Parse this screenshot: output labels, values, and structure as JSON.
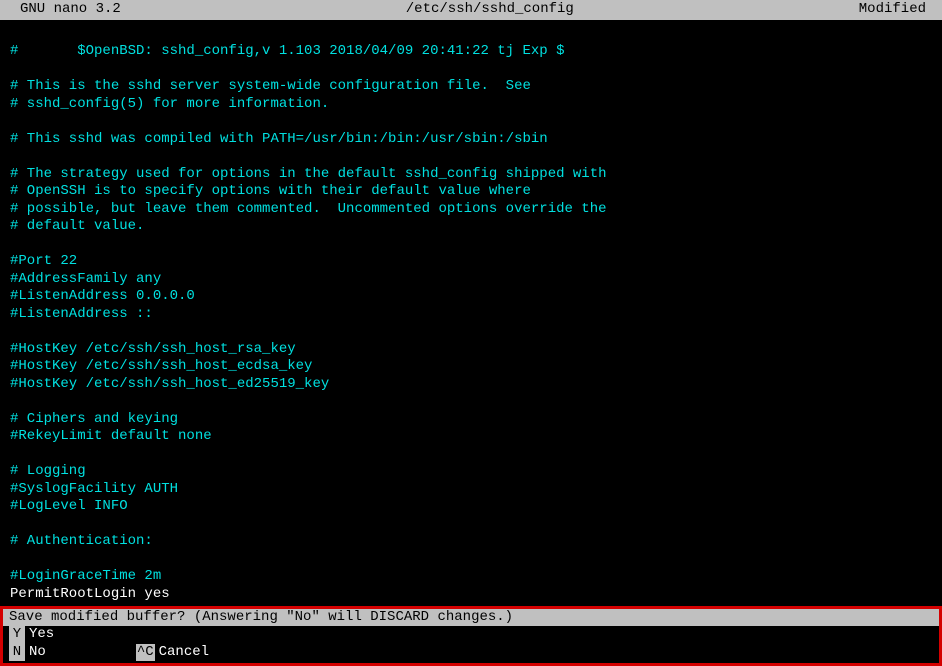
{
  "title_bar": {
    "app": "GNU nano 3.2",
    "filename": "/etc/ssh/sshd_config",
    "status": "Modified"
  },
  "content_lines": [
    "",
    "#       $OpenBSD: sshd_config,v 1.103 2018/04/09 20:41:22 tj Exp $",
    "",
    "# This is the sshd server system-wide configuration file.  See",
    "# sshd_config(5) for more information.",
    "",
    "# This sshd was compiled with PATH=/usr/bin:/bin:/usr/sbin:/sbin",
    "",
    "# The strategy used for options in the default sshd_config shipped with",
    "# OpenSSH is to specify options with their default value where",
    "# possible, but leave them commented.  Uncommented options override the",
    "# default value.",
    "",
    "#Port 22",
    "#AddressFamily any",
    "#ListenAddress 0.0.0.0",
    "#ListenAddress ::",
    "",
    "#HostKey /etc/ssh/ssh_host_rsa_key",
    "#HostKey /etc/ssh/ssh_host_ecdsa_key",
    "#HostKey /etc/ssh/ssh_host_ed25519_key",
    "",
    "# Ciphers and keying",
    "#RekeyLimit default none",
    "",
    "# Logging",
    "#SyslogFacility AUTH",
    "#LogLevel INFO",
    "",
    "# Authentication:",
    "",
    "#LoginGraceTime 2m"
  ],
  "white_line": "PermitRootLogin yes",
  "prompt": {
    "question": "Save modified buffer?  (Answering \"No\" will DISCARD changes.)",
    "options": [
      {
        "key": "Y",
        "label": "Yes"
      },
      {
        "key": "N",
        "label": "No"
      },
      {
        "key": "^C",
        "label": "Cancel"
      }
    ]
  }
}
